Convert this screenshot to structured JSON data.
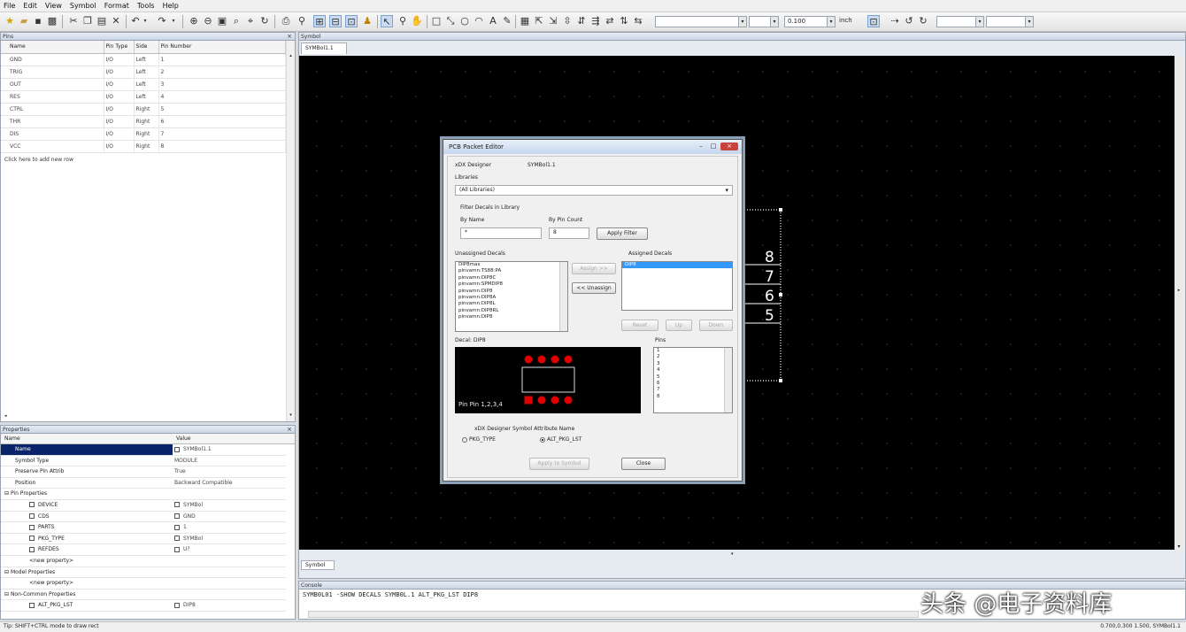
{
  "menu": [
    "File",
    "Edit",
    "View",
    "Symbol",
    "Format",
    "Tools",
    "Help"
  ],
  "toolbar": {
    "combo1": "",
    "combo2": "",
    "zoom": "0.100",
    "unit_label": "inch",
    "combo3": "",
    "combo4": ""
  },
  "pins_panel": {
    "title": "Pins",
    "headers": [
      "Name",
      "Pin Type",
      "Side",
      "Pin Number"
    ],
    "rows": [
      [
        "GND",
        "I/O",
        "Left",
        "1"
      ],
      [
        "TRIG",
        "I/O",
        "Left",
        "2"
      ],
      [
        "OUT",
        "I/O",
        "Left",
        "3"
      ],
      [
        "RES",
        "I/O",
        "Left",
        "4"
      ],
      [
        "CTRL",
        "I/O",
        "Right",
        "5"
      ],
      [
        "THR",
        "I/O",
        "Right",
        "6"
      ],
      [
        "DIS",
        "I/O",
        "Right",
        "7"
      ],
      [
        "VCC",
        "I/O",
        "Right",
        "8"
      ]
    ],
    "hint": "Click here to add new row"
  },
  "props_panel": {
    "title": "Properties",
    "headers": [
      "Name",
      "Value"
    ],
    "rows": [
      {
        "k": "Name",
        "v": "SYMBol1.1",
        "sel": true,
        "vchk": true
      },
      {
        "k": "Symbol Type",
        "v": "MODULE"
      },
      {
        "k": "Preserve Pin Attrib",
        "v": "True"
      },
      {
        "k": "Position",
        "v": "Backward Compatible"
      },
      {
        "k": "Pin Properties",
        "v": "",
        "grp": true
      },
      {
        "k": "DEVICE",
        "v": "SYMBol",
        "chk": true,
        "vchk": true
      },
      {
        "k": "CDS",
        "v": "GND",
        "chk": true,
        "vchk": true
      },
      {
        "k": "PARTS",
        "v": "1",
        "chk": true,
        "vchk": true
      },
      {
        "k": "PKG_TYPE",
        "v": "SYMBol",
        "chk": true,
        "vchk": true
      },
      {
        "k": "REFDES",
        "v": "U?",
        "chk": true,
        "vchk": true
      },
      {
        "k": "<new property>",
        "v": ""
      },
      {
        "k": "Model Properties",
        "v": "",
        "grp": true
      },
      {
        "k": "<new property>",
        "v": ""
      },
      {
        "k": "Non-Common Properties",
        "v": "",
        "grp": true
      },
      {
        "k": "ALT_PKG_LST",
        "v": "DIP8",
        "chk": true,
        "vchk": true
      }
    ]
  },
  "symbol_panel": {
    "title": "Symbol",
    "tab": "SYMBol1.1",
    "bottom_tab": "Symbol"
  },
  "canvas": {
    "pin_numbers": [
      "8",
      "7",
      "6",
      "5"
    ]
  },
  "dialog": {
    "title": "PCB Packet Editor",
    "designer_label": "xDX Designer",
    "designer_value": "SYMBol1.1",
    "library_label": "Libraries",
    "library_value": "(All Libraries)",
    "filter_label": "Filter Decals in Library",
    "by_name_label": "By Name",
    "by_name_value": "*",
    "by_pin_label": "By Pin Count",
    "by_pin_value": "8",
    "apply_filter": "Apply Filter",
    "unassigned_label": "Unassigned Decals",
    "unassigned_items": [
      "DIP8max",
      "pinvamn:TS88:PA",
      "pinvamn:DIP8C",
      "pinvamn:SPMDIP8",
      "pinvamn:DIP8",
      "pinvamn:DIP8A",
      "pinvamn:DIP8L",
      "pinvamn:DIP8RL",
      "pinvamn:DIP8"
    ],
    "assign_btn": "Assign >>",
    "unassign_btn": "<< Unassign",
    "assigned_label": "Assigned Decals",
    "assigned_items": [
      "DIP8"
    ],
    "reset_btn": "Reset",
    "up_btn": "Up",
    "down_btn": "Down",
    "decal_label": "Decal: DIP8",
    "preview_text": "Pin  Pin  1,2,3,4",
    "pins_label": "Pins",
    "pins_items": [
      "1",
      "2",
      "3",
      "4",
      "5",
      "6",
      "7",
      "8"
    ],
    "attr_label": "xDX Designer Symbol Attribute Name",
    "radio1": "PKG_TYPE",
    "radio2": "ALT_PKG_LST",
    "apply_btn": "Apply to Symbol",
    "close_btn": "Close"
  },
  "console": {
    "title": "Console",
    "text": "SYMB0L01 -SHOW DECALS SYMB0L.1 ALT_PKG_LST DIP8"
  },
  "status": {
    "left": "Tip: SHIFT+CTRL mode to draw rect",
    "right": "0.700,0.300 1.500, SYMBol1.1"
  },
  "watermark": "头条 @电子资料库",
  "colors": {
    "selection": "#0a246a",
    "canvas": "#000000",
    "dialog_accent": "#8aa0b8",
    "pad": "#e00000"
  }
}
